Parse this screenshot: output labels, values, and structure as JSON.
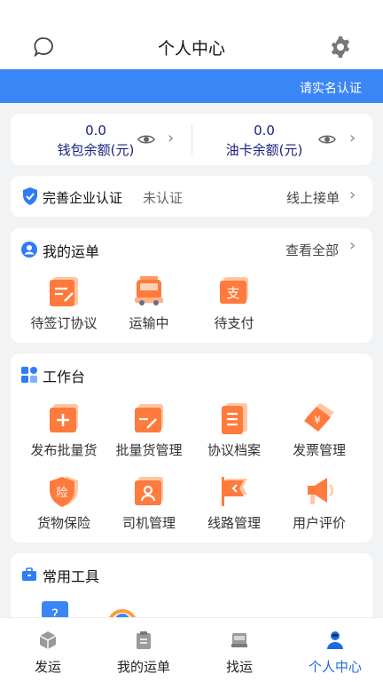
{
  "header": {
    "title": "个人中心",
    "chat_icon": "chat-bubble-icon",
    "settings_icon": "gear-icon"
  },
  "banner": {
    "verify_label": "请实名认证",
    "color": "#3b86f5"
  },
  "wallet": {
    "left": {
      "value": "0.0",
      "label": "钱包余额(元)"
    },
    "right": {
      "value": "0.0",
      "label": "油卡余额(元)"
    }
  },
  "certification": {
    "title": "完善企业认证",
    "status": "未认证",
    "action": "线上接单"
  },
  "my_orders": {
    "title": "我的运单",
    "view_all": "查看全部",
    "items": [
      {
        "label": "待签订协议",
        "icon": "sign-agreement-icon"
      },
      {
        "label": "运输中",
        "icon": "truck-icon"
      },
      {
        "label": "待支付",
        "icon": "payment-icon"
      }
    ]
  },
  "workbench": {
    "title": "工作台",
    "items": [
      {
        "label": "发布批量货",
        "icon": "publish-icon"
      },
      {
        "label": "批量货管理",
        "icon": "cargo-manage-icon"
      },
      {
        "label": "协议档案",
        "icon": "agreement-archive-icon"
      },
      {
        "label": "发票管理",
        "icon": "invoice-icon"
      },
      {
        "label": "货物保险",
        "icon": "insurance-icon"
      },
      {
        "label": "司机管理",
        "icon": "driver-manage-icon"
      },
      {
        "label": "线路管理",
        "icon": "route-flag-icon"
      },
      {
        "label": "用户评价",
        "icon": "review-megaphone-icon"
      }
    ]
  },
  "tools": {
    "title": "常用工具"
  },
  "tabbar": {
    "items": [
      {
        "label": "发运",
        "icon": "box-icon"
      },
      {
        "label": "我的运单",
        "icon": "clipboard-icon"
      },
      {
        "label": "找运",
        "icon": "truck-icon"
      },
      {
        "label": "个人中心",
        "icon": "person-icon",
        "active": true
      }
    ],
    "active_color": "#1e6be0"
  }
}
